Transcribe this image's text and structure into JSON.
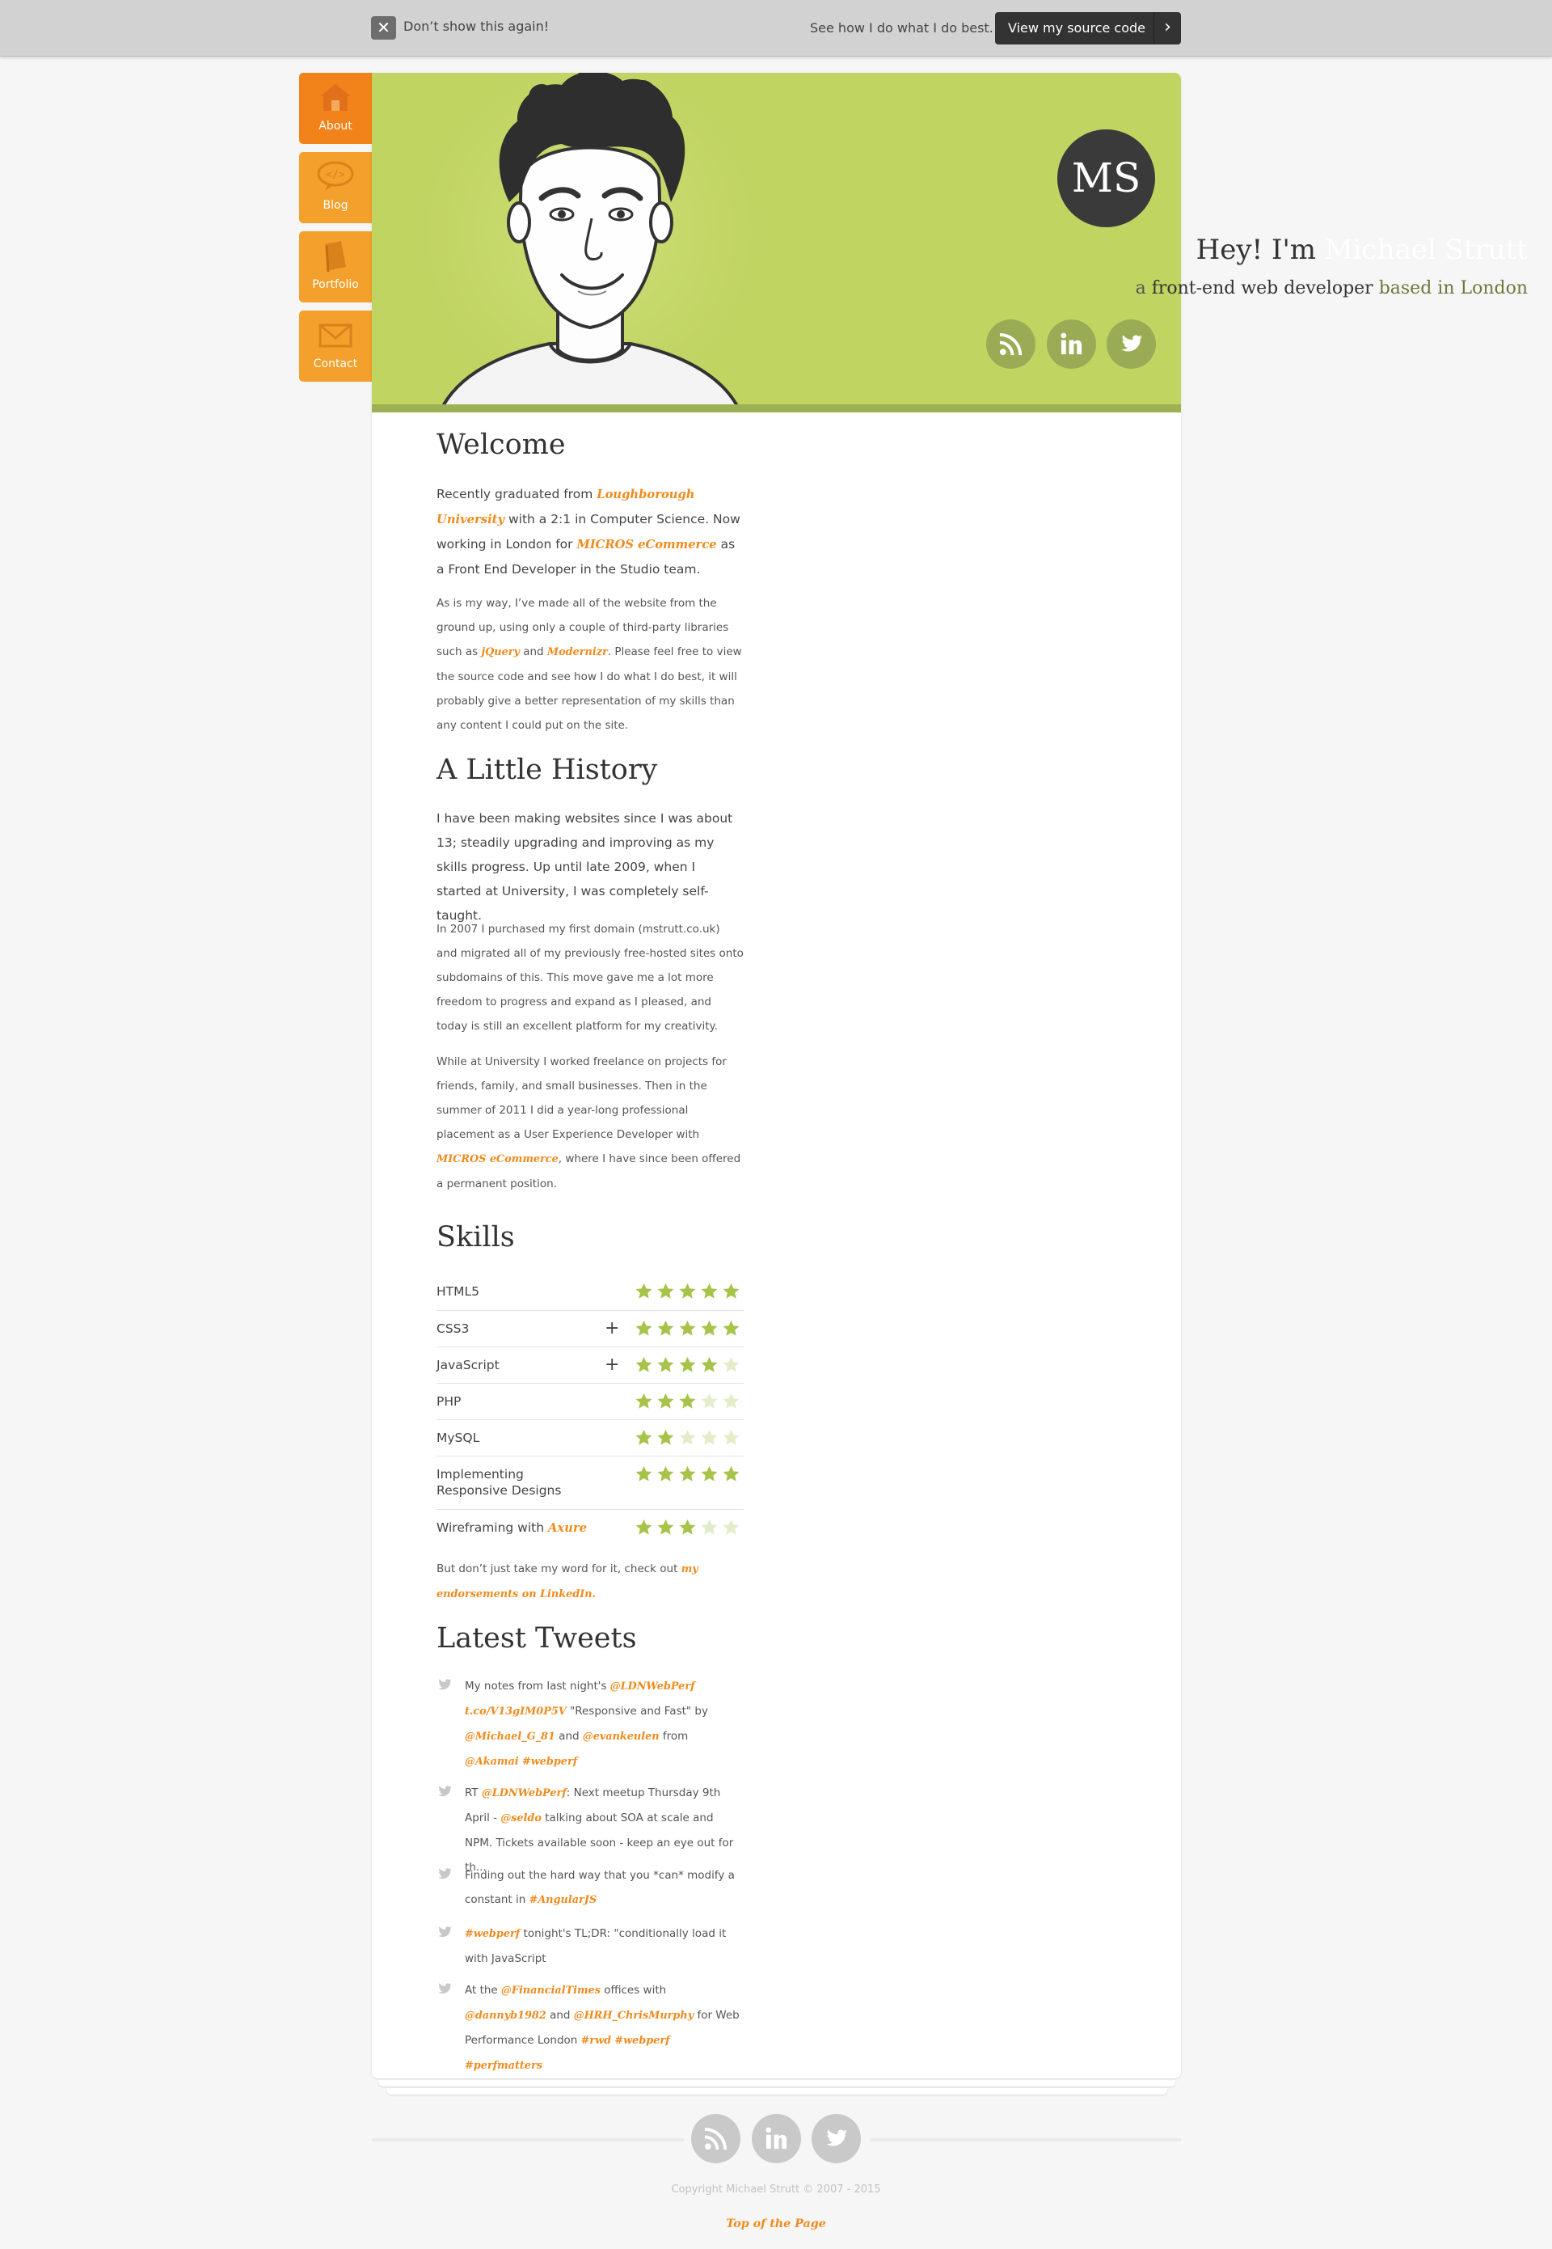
{
  "topbar": {
    "dont_show": "Don’t show this again!",
    "see_how": "See how I do what I do best.",
    "source_button": "View my source code"
  },
  "nav": [
    {
      "label": "About",
      "icon": "house-icon"
    },
    {
      "label": "Blog",
      "icon": "code-bubble-icon"
    },
    {
      "label": "Portfolio",
      "icon": "book-icon"
    },
    {
      "label": "Contact",
      "icon": "envelope-icon"
    }
  ],
  "hero": {
    "monogram": "MS",
    "greeting": "Hey! I'm ",
    "name": "Michael Strutt",
    "sub_a": "a ",
    "sub_role": "front-end web developer",
    "sub_based": " based in London",
    "social": [
      "rss-icon",
      "linkedin-icon",
      "twitter-icon"
    ]
  },
  "welcome": {
    "title": "Welcome",
    "p1_a": "Recently graduated from ",
    "p1_link1": "Loughborough University",
    "p1_b": " with a 2:1 in Computer Science. Now working in London for ",
    "p1_link2": "MICROS eCommerce",
    "p1_c": " as a Front End Developer in the Studio team.",
    "p2_a": "As is my way, I’ve made all of the website from the ground up, using only a couple of third-party libraries such as ",
    "p2_link1": "jQuery",
    "p2_b": " and ",
    "p2_link2": "Modernizr",
    "p2_c": ". Please feel free to view the source code and see how I do what I do best, it will probably give a better representation of my skills than any content I could put on the site."
  },
  "history": {
    "title": "A Little History",
    "p1": "I have been making websites since I was about 13; steadily upgrading and improving as my skills progress. Up until late 2009, when I started at University, I was completely self-taught.",
    "p2": "In 2007 I purchased my first domain (mstrutt.co.uk) and migrated all of my previously free-hosted sites onto subdomains of this. This move gave me a lot more freedom to progress and expand as I pleased, and today is still an excellent platform for my creativity.",
    "p3_a": "While at University I worked freelance on projects for friends, family, and small businesses. Then in the summer of 2011 I did a year-long professional placement as a User Experience Developer with ",
    "p3_link": "MICROS eCommerce",
    "p3_b": ", where I have since been offered a permanent position."
  },
  "skills": {
    "title": "Skills",
    "items": [
      {
        "name": "HTML5",
        "rating": 5,
        "expandable": false
      },
      {
        "name": "CSS3",
        "rating": 5,
        "expandable": true
      },
      {
        "name": "JavaScript",
        "rating": 4,
        "expandable": true
      },
      {
        "name": "PHP",
        "rating": 3,
        "expandable": false
      },
      {
        "name": "MySQL",
        "rating": 2,
        "expandable": false
      },
      {
        "name": "Implementing Responsive Designs",
        "rating": 5,
        "expandable": false
      },
      {
        "name": "Wireframing with ",
        "link": "Axure",
        "rating": 3,
        "expandable": false
      }
    ],
    "note_a": "But don’t just take my word for it, check out ",
    "note_link": "my endorsements on LinkedIn."
  },
  "tweets": {
    "title": "Latest Tweets",
    "t1_a": "My notes from last night's ",
    "t1_l1": "@LDNWebPerf",
    "t1_l2": "t.co/V13gIM0P5V",
    "t1_b": " \"Responsive and Fast\" by ",
    "t1_l3": "@Michael_G_81",
    "t1_c": " and ",
    "t1_l4": "@evankeulen",
    "t1_d": " from ",
    "t1_l5": "@Akamai",
    "t1_l6": "#webperf",
    "t2_a": "RT ",
    "t2_l1": "@LDNWebPerf",
    "t2_b": ": Next meetup Thursday 9th April - ",
    "t2_l2": "@seldo",
    "t2_c": " talking about SOA at scale and NPM. Tickets available soon - keep an eye out for th...",
    "t3_a": "Finding out the hard way that you *can* modify a constant in ",
    "t3_l1": "#AngularJS",
    "t4_l1": "#webperf",
    "t4_a": " tonight's TL;DR: \"conditionally load it with JavaScript",
    "t5_a": "At the ",
    "t5_l1": "@FinancialTimes",
    "t5_b": " offices with ",
    "t5_l2": "@dannyb1982",
    "t5_c": " and ",
    "t5_l3": "@HRH_ChrisMurphy",
    "t5_d": " for Web Performance London ",
    "t5_l4": "#rwd",
    "t5_l5": "#webperf",
    "t5_l6": "#perfmatters"
  },
  "footer": {
    "copyright": "Copyright Michael Strutt © 2007 - 2015",
    "top_link": "Top of the Page"
  },
  "colors": {
    "accent": "#f08a1c",
    "hero_green": "#c0d462",
    "nav_orange": "#f4a02c",
    "star_green": "#a8c34a"
  }
}
